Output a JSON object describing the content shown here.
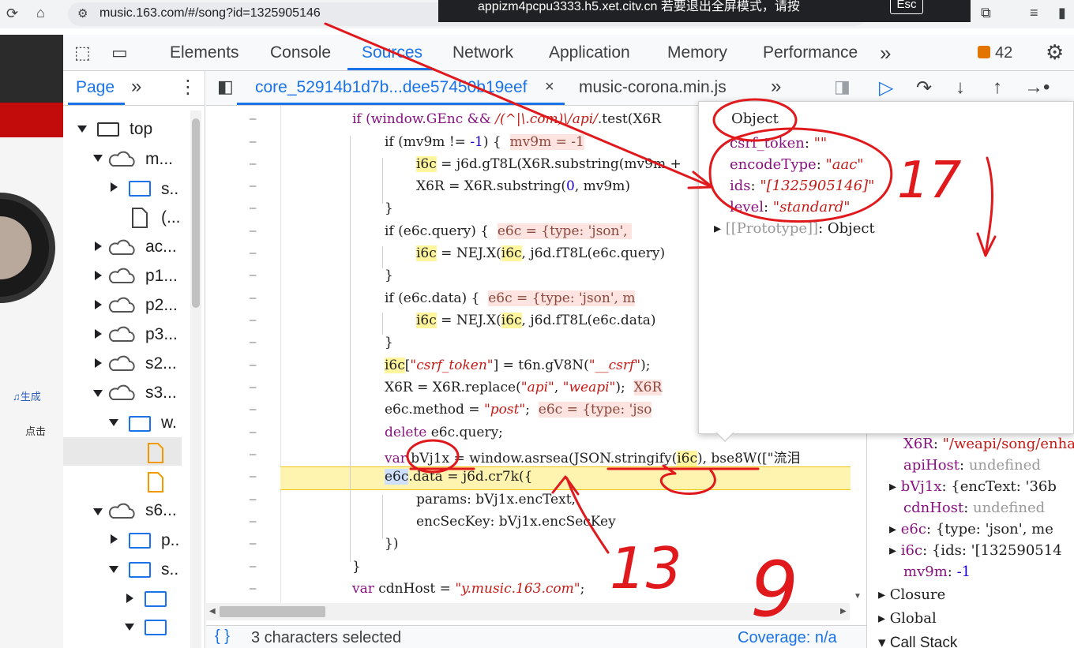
{
  "browser": {
    "url": "music.163.com/#/song?id=1325905146",
    "banner_text": "appizm4pcpu3333.h5.xet.citv.cn    若要退出全屏模式，请按",
    "esc_label": "Esc"
  },
  "page_bg": {
    "text1": "♫生成",
    "text2": "点击"
  },
  "devtools": {
    "tabs": [
      "Elements",
      "Console",
      "Sources",
      "Network",
      "Application",
      "Memory",
      "Performance"
    ],
    "more_tabs": "»",
    "issues_count": "42"
  },
  "navigator": {
    "tab": "Page",
    "more": "»",
    "items": [
      {
        "label": "top"
      },
      {
        "label": "m..."
      },
      {
        "label": "s.."
      },
      {
        "label": "(..."
      },
      {
        "label": "ac..."
      },
      {
        "label": "p1..."
      },
      {
        "label": "p2..."
      },
      {
        "label": "p3..."
      },
      {
        "label": "s2..."
      },
      {
        "label": "s3..."
      },
      {
        "label": "w."
      },
      {
        "label": "s6..."
      },
      {
        "label": "p.."
      },
      {
        "label": "s.."
      }
    ]
  },
  "editor": {
    "tab_active": "core_52914b1d7b...dee57450b19eef",
    "tab_close": "×",
    "tab_other": "music-corona.min.js",
    "more": "»",
    "line_marker": "–"
  },
  "code": {
    "l1a": "if (window.GEnc && ",
    "l1b": "/(^|\\.com)\\/api/",
    "l1c": ".test(X6R",
    "l2a": "if (mv9m != ",
    "l2b": "-1",
    "l2c": ") {  ",
    "l2d": "mv9m = -1",
    "l3a": "i6c",
    "l3b": " = j6d.gT8L(X6R.substring(mv9m + ",
    "l4a": "X6R = X6R.substring(",
    "l4b": "0",
    "l4c": ", mv9m)",
    "l5": "}",
    "l6a": "if (e6c.query) {  ",
    "l6b": "e6c = {type: 'json', ",
    "l7a": "i6c",
    "l7b": " = NEJ.X(",
    "l7c": "i6c",
    "l7d": ", j6d.fT8L(e6c.query)",
    "l8": "}",
    "l9a": "if (e6c.data) {  ",
    "l9b": "e6c = {type: 'json', m",
    "l10a": "i6c",
    "l10b": " = NEJ.X(",
    "l10c": "i6c",
    "l10d": ", j6d.fT8L(e6c.data)",
    "l11": "}",
    "l12a": "i6c",
    "l12b": "[",
    "l12c": "\"csrf_token\"",
    "l12d": "] = t6n.gV8N(",
    "l12e": "\"__csrf\"",
    "l12f": ");",
    "l13a": "X6R = X6R.replace(",
    "l13b": "\"api\"",
    "l13c": ", ",
    "l13d": "\"weapi\"",
    "l13e": ");  ",
    "l13f": "X6R",
    "l14a": "e6c.method = ",
    "l14b": "\"post\"",
    "l14c": ";  ",
    "l14d": "e6c = {type: 'jso",
    "l15a": "delete",
    "l15b": " e6c.query;",
    "l16a": "var",
    "l16b": " bVj1x = window.asrsea(JSON.stringify(",
    "l16c": "i6c",
    "l16d": "), bse8W([\"流泪",
    "l17a": "e6c",
    "l17b": ".data = j6d.cr7k({",
    "l18": "params: bVj1x.encText,",
    "l19": "encSecKey: bVj1x.encSecKey",
    "l20": "})",
    "l21": "}",
    "l22a": "var",
    "l22b": " cdnHost = ",
    "l22c": "\"y.music.163.com\"",
    "l22d": ";"
  },
  "popover": {
    "title": "Object",
    "fields": [
      {
        "key": "csrf_token",
        "value": "\"\""
      },
      {
        "key": "encodeType",
        "value": "\"aac\""
      },
      {
        "key": "ids",
        "value": "\"[1325905146]\""
      },
      {
        "key": "level",
        "value": "\"standard\""
      }
    ],
    "proto_a": "[[Prototype]]",
    "proto_b": ": Object"
  },
  "scope": {
    "x6r_key": "X6R",
    "x6r_val": "\"/weapi/song/enha",
    "apihost_key": "apiHost",
    "apihost_val": "undefined",
    "bvj_key": "bVj1x",
    "bvj_val": "{encText: '36b",
    "cdn_key": "cdnHost",
    "cdn_val": "undefined",
    "e6c_key": "e6c",
    "e6c_val": "{type: 'json', me",
    "i6c_key": "i6c",
    "i6c_val": "{ids: '[132590514",
    "mv9m_key": "mv9m",
    "mv9m_val": "-1",
    "closure": "Closure",
    "global": "Global",
    "callstack": "Call Stack"
  },
  "statusbar": {
    "selection": "3 characters selected",
    "coverage": "Coverage: n/a"
  },
  "annotations": {
    "n1": "17",
    "n2": "13",
    "n3": "9"
  },
  "colors": {
    "accent": "#1a73e8",
    "annotation": "#e0191d",
    "keyword": "#881280",
    "string": "#c41a16"
  }
}
